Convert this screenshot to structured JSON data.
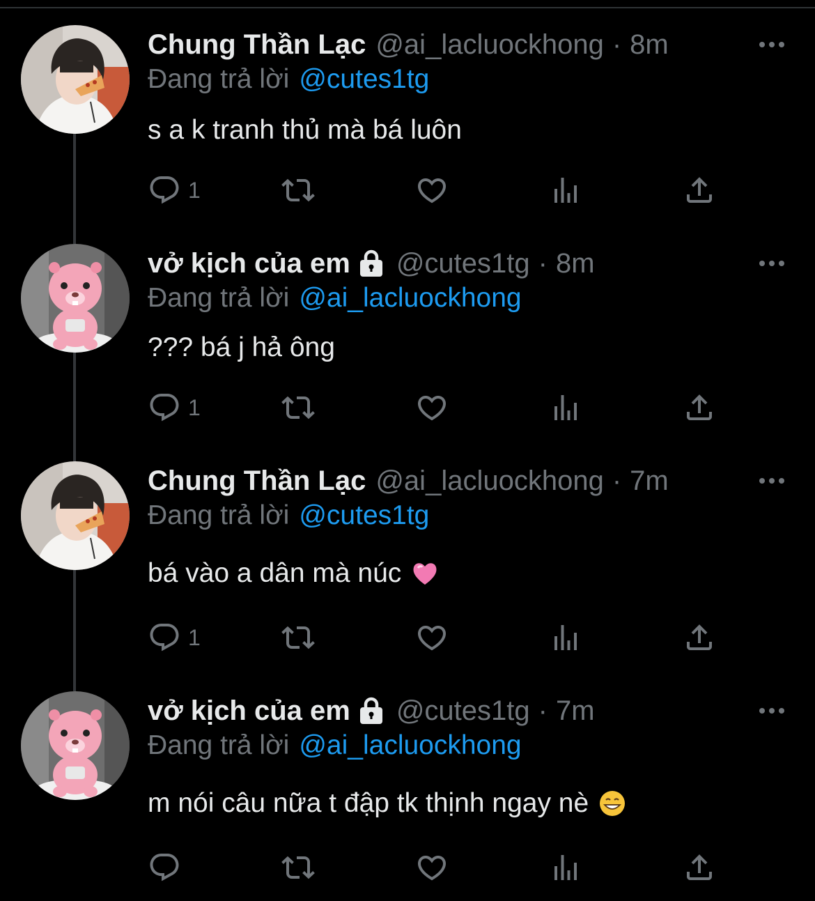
{
  "thread": [
    {
      "author": {
        "name": "Chung Thần Lạc",
        "handle": "@ai_lacluockhong",
        "locked": false,
        "avatar": "boy-eating-pizza-avatar"
      },
      "separator": "·",
      "time": "8m",
      "replying_label": "Đang trả lời",
      "replying_to": "@cutes1tg",
      "text": "s a k tranh thủ mà bá luôn",
      "emoji": null,
      "reply_count": "1"
    },
    {
      "author": {
        "name": "vở kịch của em",
        "handle": "@cutes1tg",
        "locked": true,
        "avatar": "pink-beaver-loopy-avatar"
      },
      "separator": "·",
      "time": "8m",
      "replying_label": "Đang trả lời",
      "replying_to": "@ai_lacluockhong",
      "text": "??? bá j hả ông",
      "emoji": null,
      "reply_count": "1"
    },
    {
      "author": {
        "name": "Chung Thần Lạc",
        "handle": "@ai_lacluockhong",
        "locked": false,
        "avatar": "boy-eating-pizza-avatar"
      },
      "separator": "·",
      "time": "7m",
      "replying_label": "Đang trả lời",
      "replying_to": "@cutes1tg",
      "text": "bá vào a dân mà núc",
      "emoji": "pink-heart-emoji",
      "reply_count": "1"
    },
    {
      "author": {
        "name": "vở kịch của em",
        "handle": "@cutes1tg",
        "locked": true,
        "avatar": "pink-beaver-loopy-avatar"
      },
      "separator": "·",
      "time": "7m",
      "replying_label": "Đang trả lời",
      "replying_to": "@ai_lacluockhong",
      "text": "m nói câu nữa t đập tk thịnh ngay nè",
      "emoji": "grinning-face-emoji",
      "reply_count": ""
    }
  ],
  "icons": {
    "more": "more-options-icon",
    "reply": "reply-icon",
    "retweet": "retweet-icon",
    "like": "like-icon",
    "views": "views-icon",
    "share": "share-icon",
    "lock": "lock-icon"
  },
  "colors": {
    "background": "#000000",
    "text": "#e7e9ea",
    "secondary": "#71767b",
    "link": "#1d9bf0",
    "thread_line": "#333639"
  }
}
